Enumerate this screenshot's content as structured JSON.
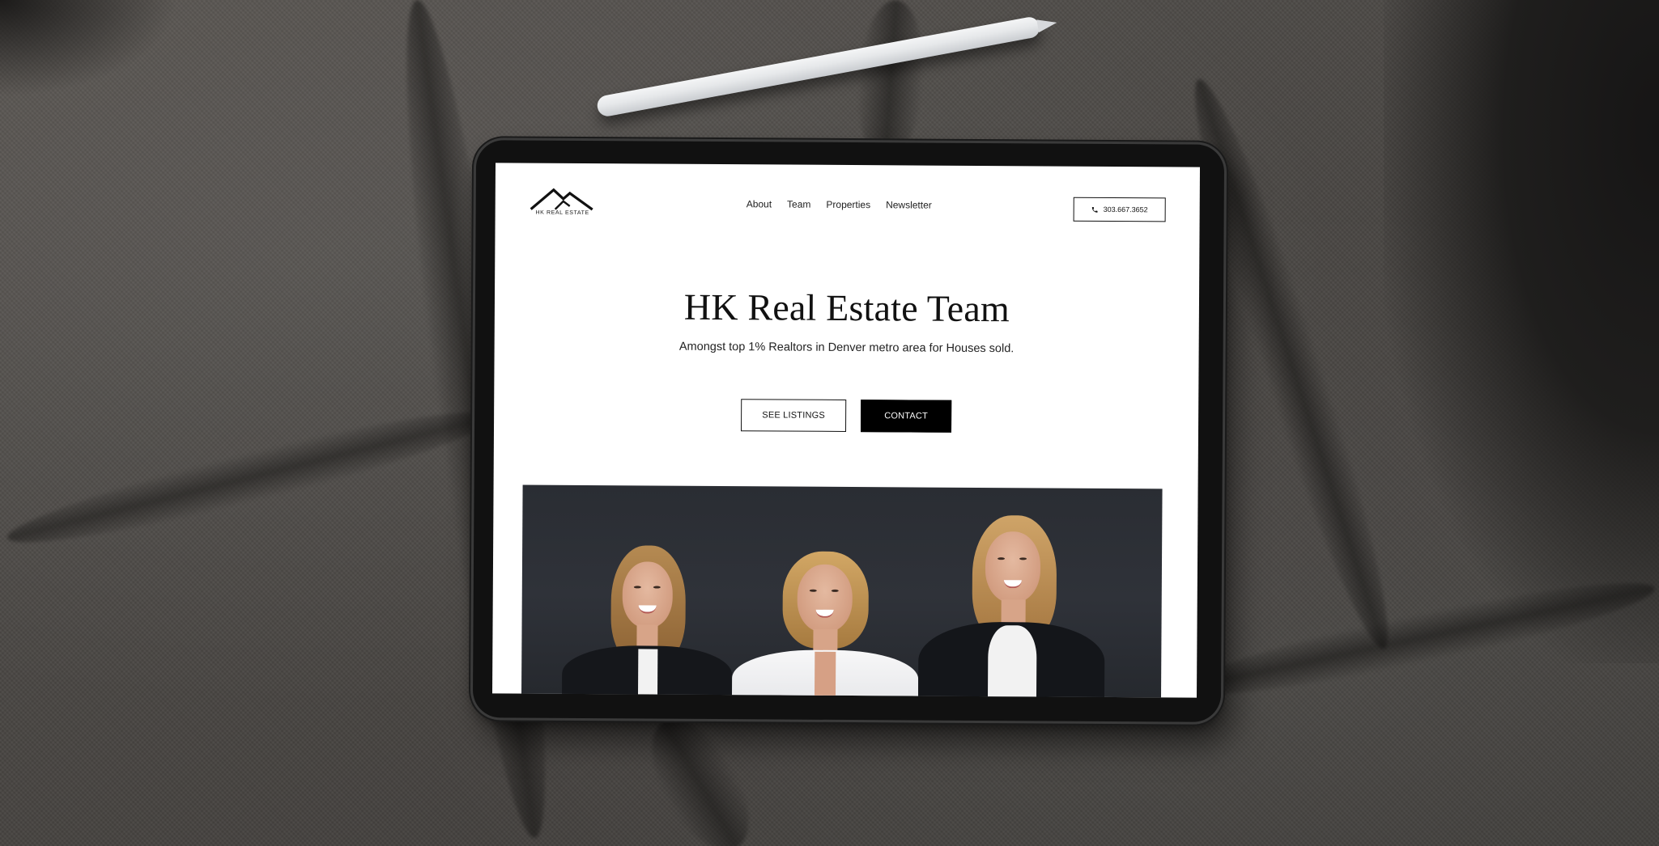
{
  "site": {
    "logo": {
      "text": "HK REAL ESTATE",
      "icon": "mountain-icon"
    },
    "nav": {
      "items": [
        "About",
        "Team",
        "Properties",
        "Newsletter"
      ]
    },
    "phone": {
      "icon": "phone-icon",
      "number": "303.667.3652"
    }
  },
  "hero": {
    "title": "HK Real Estate Team",
    "subtitle": "Amongst top 1% Realtors in Denver metro area for Houses sold.",
    "buttons": {
      "listings": "SEE LISTINGS",
      "contact": "CONTACT"
    }
  },
  "team_photo": {
    "people_count": 3
  },
  "colors": {
    "page_background": "#ffffff",
    "text": "#111111",
    "button_solid": "#000000",
    "photo_background": "#2c2f35",
    "fabric": "#4a4744"
  }
}
